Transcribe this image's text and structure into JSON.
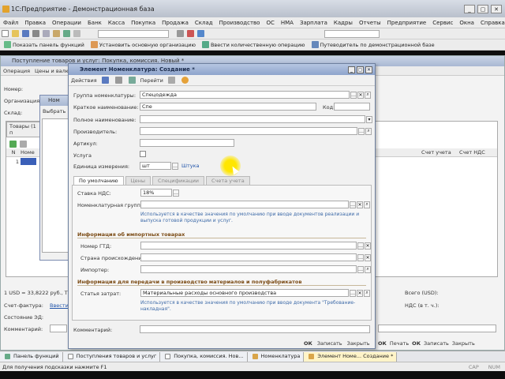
{
  "window": {
    "title": "1С:Предприятие - Демонстрационная база"
  },
  "menu": [
    "Файл",
    "Правка",
    "Операции",
    "Банк",
    "Касса",
    "Покупка",
    "Продажа",
    "Склад",
    "Производство",
    "ОС",
    "НМА",
    "Зарплата",
    "Кадры",
    "Отчеты",
    "Предприятие",
    "Сервис",
    "Окна",
    "Справка"
  ],
  "toolbar2": {
    "show_panel": "Показать панель функций",
    "set_main_org": "Установить основную организацию",
    "enter_initial": "Ввести количественную операцию",
    "guide": "Путеводитель по демонстрационной базе"
  },
  "bgwindow": {
    "title": "Поступление товаров и услуг: Покупка, комиссия. Новый *",
    "ops_label": "Операция",
    "prices_label": "Цены и валюта...",
    "number_label": "Номер:",
    "org_label": "Организация:",
    "warehouse_label": "Склад:",
    "tab_goods": "Товары (1 п",
    "col_n": "N",
    "col_nom": "Номе",
    "row_n": "1",
    "sum_col": "Счет учета",
    "vat_col": "Счет НДС",
    "rate": "1 USD = 33,8222 руб., Ти",
    "total_usd": "Всего (USD):",
    "invoice_label": "Счет-фактура:",
    "invoice_link": "Ввести",
    "vat_label": "НДС (в т. ч.):",
    "state_label": "Состояние ЭД:",
    "comment_label": "Комментарий:",
    "btn_ok": "ОК",
    "btn_save": "Записать",
    "btn_close": "Закрыть",
    "btn_print": "Печать",
    "btn_ok2": "ОК",
    "btn_save2": "Записать",
    "btn_close2": "Закрыть",
    "sub_title": "Ном",
    "sub_choose": "Выбрать"
  },
  "dialog": {
    "title": "Элемент Номенклатура: Создание *",
    "actions": "Действия",
    "goto": "Перейти",
    "group_label": "Группа номенклатуры:",
    "group_value": "Спецодежда",
    "short_label": "Краткое наименование:",
    "short_value": "Спе",
    "code_label": "Код:",
    "full_label": "Полное наименование:",
    "maker_label": "Производитель:",
    "article_label": "Артикул:",
    "service_label": "Услуга",
    "unit_label": "Единица измерения:",
    "unit_value": "шт",
    "unit_link": "Штука",
    "tabs": [
      "По умолчанию",
      "Цены",
      "Спецификации",
      "Счета учета"
    ],
    "vat_label": "Ставка НДС:",
    "vat_value": "18%",
    "nomgroup_label": "Номенклатурная группа:",
    "hint1": "Используется в качестве значения по умолчанию при вводе документов  реализации и выпуска готовой продукции и услуг.",
    "import_section": "Информация об импортных товарах",
    "gtd_label": "Номер ГТД:",
    "country_label": "Страна происхождения:",
    "importer_label": "Импортер:",
    "prod_section": "Информация для передачи в производство материалов и полуфабрикатов",
    "cost_label": "Статья затрат:",
    "cost_value": "Материальные расходы основного производства",
    "hint2": "Используется в качестве значения по умолчанию при вводе документа \"Требование-накладная\".",
    "comment_label": "Комментарий:",
    "btn_ok": "ОК",
    "btn_save": "Записать",
    "btn_close": "Закрыть"
  },
  "taskbar": [
    "Панель функций",
    "Поступления товаров и услуг",
    "Покупка, комиссия. Нов...",
    "Номенклатура",
    "Элемент Номе... Создание *"
  ],
  "status": {
    "hint": "Для получения подсказки нажмите F1",
    "cap": "CAP",
    "num": "NUM"
  }
}
